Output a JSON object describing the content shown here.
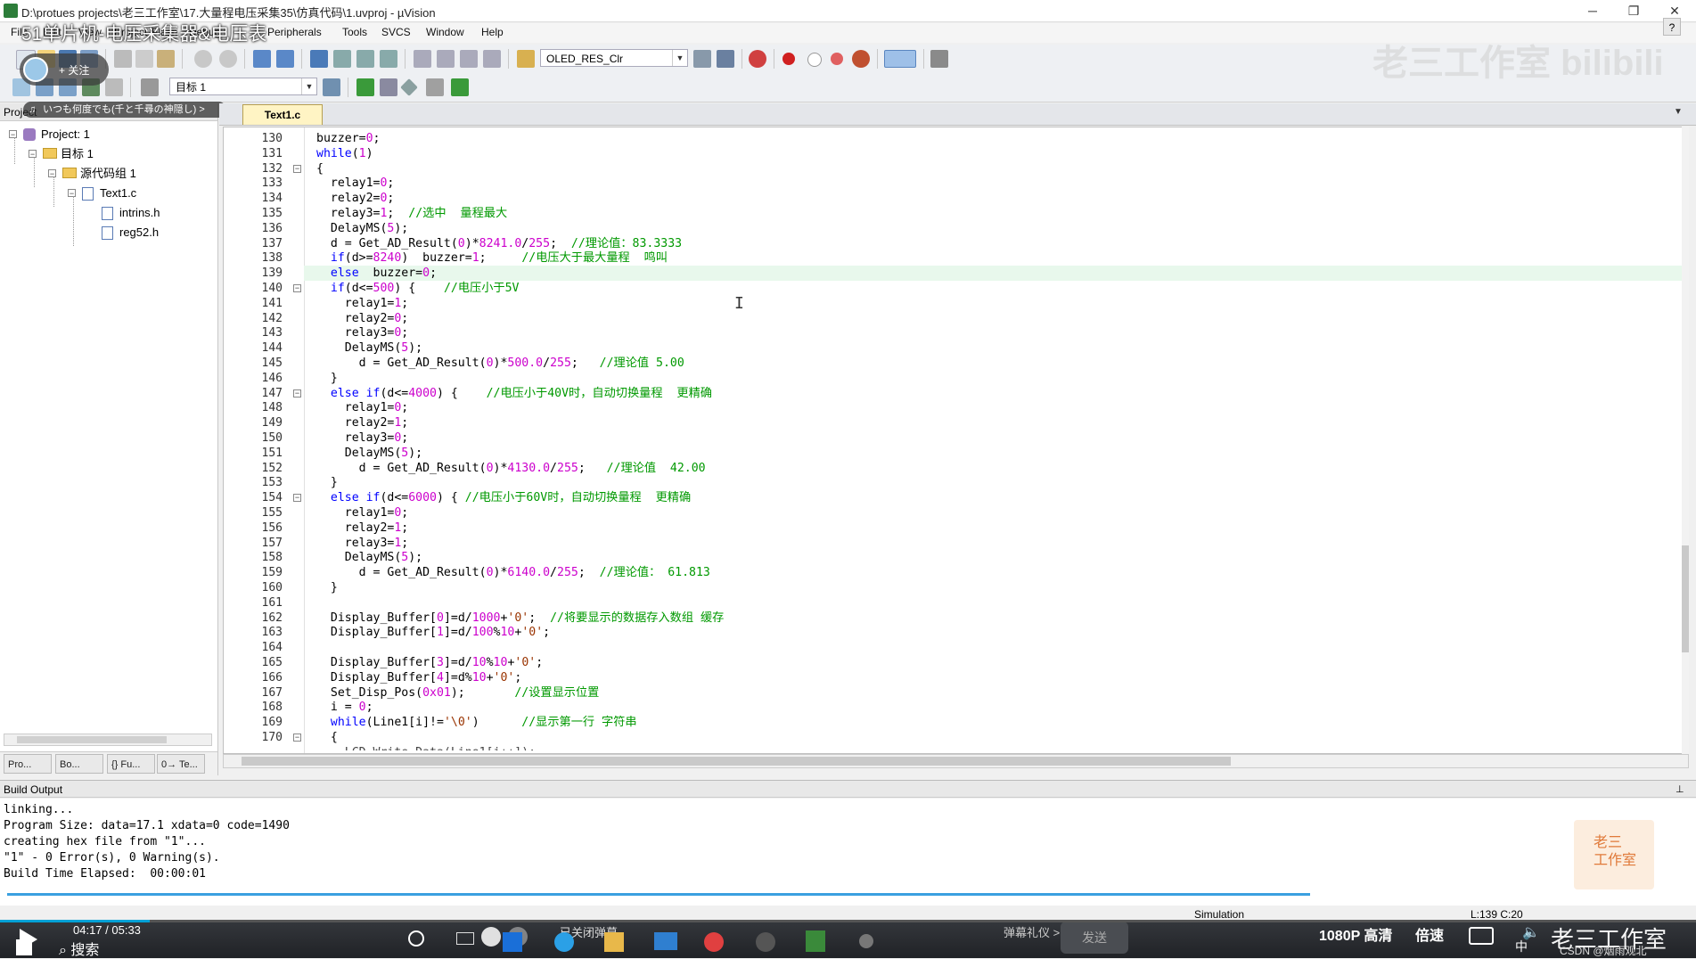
{
  "window": {
    "title": "D:\\protues projects\\老三工作室\\17.大量程电压采集35\\仿真代码\\1.uvproj - µVision",
    "minimize_glyph": "─",
    "maximize_glyph": "❐",
    "close_glyph": "✕",
    "help_glyph": "?"
  },
  "overlay": {
    "video_title": "51单片机-电压采集器&电压表",
    "follow_label": "+ 关注",
    "music_text": "いつも何度でも(千と千尋の神隠し) >",
    "watermark": "老三工作室 bilibili"
  },
  "menubar": [
    "File",
    "Edit",
    "View",
    "Project",
    "Flash",
    "Debug",
    "Peripherals",
    "Tools",
    "SVCS",
    "Window",
    "Help"
  ],
  "toolbar": {
    "target_combo": "OLED_RES_Clr",
    "target_select": "目标 1"
  },
  "project_panel": {
    "header": "Project",
    "tree": [
      {
        "label": "Project: 1",
        "level": 0,
        "icon": "project-icon",
        "expander": "-"
      },
      {
        "label": "目标 1",
        "level": 1,
        "icon": "target-folder-icon",
        "expander": "-"
      },
      {
        "label": "源代码组 1",
        "level": 2,
        "icon": "folder-icon",
        "expander": "-"
      },
      {
        "label": "Text1.c",
        "level": 3,
        "icon": "file-icon",
        "expander": "-"
      },
      {
        "label": "intrins.h",
        "level": 4,
        "icon": "header-file-icon",
        "expander": ""
      },
      {
        "label": "reg52.h",
        "level": 4,
        "icon": "header-file-icon",
        "expander": ""
      }
    ],
    "tabs": [
      "Pro...",
      "Bo...",
      "{} Fu...",
      "0→ Te..."
    ]
  },
  "editor": {
    "tab_label": "Text1.c",
    "cursor_position": "L:139 C:20",
    "highlighted_line": 139,
    "lines": [
      {
        "n": "130",
        "fold": "",
        "code": [
          [
            "buzzer=",
            ""
          ],
          [
            "0",
            "num"
          ],
          [
            ";",
            ""
          ]
        ]
      },
      {
        "n": "131",
        "fold": "",
        "code": [
          [
            "while",
            "kw"
          ],
          [
            "(",
            ""
          ],
          [
            "1",
            "num"
          ],
          [
            ")",
            ""
          ]
        ]
      },
      {
        "n": "132",
        "fold": "-",
        "code": [
          [
            "{",
            ""
          ]
        ]
      },
      {
        "n": "133",
        "fold": "",
        "code": [
          [
            "  relay1=",
            ""
          ],
          [
            "0",
            "num"
          ],
          [
            ";",
            ""
          ]
        ]
      },
      {
        "n": "134",
        "fold": "",
        "code": [
          [
            "  relay2=",
            ""
          ],
          [
            "0",
            "num"
          ],
          [
            ";",
            ""
          ]
        ]
      },
      {
        "n": "135",
        "fold": "",
        "code": [
          [
            "  relay3=",
            ""
          ],
          [
            "1",
            "num"
          ],
          [
            ";  ",
            ""
          ],
          [
            "//选中  量程最大",
            "cmt"
          ]
        ]
      },
      {
        "n": "136",
        "fold": "",
        "code": [
          [
            "  DelayMS(",
            ""
          ],
          [
            "5",
            "num"
          ],
          [
            ");",
            ""
          ]
        ]
      },
      {
        "n": "137",
        "fold": "",
        "code": [
          [
            "  d = Get_AD_Result(",
            ""
          ],
          [
            "0",
            "num"
          ],
          [
            ")*",
            ""
          ],
          [
            "8241.0",
            "num"
          ],
          [
            "/",
            ""
          ],
          [
            "255",
            "num"
          ],
          [
            ";  ",
            ""
          ],
          [
            "//理论值：83.3333",
            "cmt"
          ]
        ]
      },
      {
        "n": "138",
        "fold": "",
        "code": [
          [
            "  ",
            ""
          ],
          [
            "if",
            "kw"
          ],
          [
            "(d>=",
            ""
          ],
          [
            "8240",
            "num"
          ],
          [
            ")  buzzer=",
            ""
          ],
          [
            "1",
            "num"
          ],
          [
            ";     ",
            ""
          ],
          [
            "//电压大于最大量程  鸣叫",
            "cmt"
          ]
        ]
      },
      {
        "n": "139",
        "fold": "",
        "code": [
          [
            "  ",
            ""
          ],
          [
            "else",
            "kw"
          ],
          [
            "  buzzer=",
            ""
          ],
          [
            "0",
            "num"
          ],
          [
            ";",
            ""
          ]
        ]
      },
      {
        "n": "140",
        "fold": "-",
        "code": [
          [
            "  ",
            ""
          ],
          [
            "if",
            "kw"
          ],
          [
            "(d<=",
            ""
          ],
          [
            "500",
            "num"
          ],
          [
            ") {    ",
            ""
          ],
          [
            "//电压小于5V",
            "cmt"
          ]
        ]
      },
      {
        "n": "141",
        "fold": "",
        "code": [
          [
            "    relay1=",
            ""
          ],
          [
            "1",
            "num"
          ],
          [
            ";",
            ""
          ]
        ]
      },
      {
        "n": "142",
        "fold": "",
        "code": [
          [
            "    relay2=",
            ""
          ],
          [
            "0",
            "num"
          ],
          [
            ";",
            ""
          ]
        ]
      },
      {
        "n": "143",
        "fold": "",
        "code": [
          [
            "    relay3=",
            ""
          ],
          [
            "0",
            "num"
          ],
          [
            ";",
            ""
          ]
        ]
      },
      {
        "n": "144",
        "fold": "",
        "code": [
          [
            "    DelayMS(",
            ""
          ],
          [
            "5",
            "num"
          ],
          [
            ");",
            ""
          ]
        ]
      },
      {
        "n": "145",
        "fold": "",
        "code": [
          [
            "      d = Get_AD_Result(",
            ""
          ],
          [
            "0",
            "num"
          ],
          [
            ")*",
            ""
          ],
          [
            "500.0",
            "num"
          ],
          [
            "/",
            ""
          ],
          [
            "255",
            "num"
          ],
          [
            ";   ",
            ""
          ],
          [
            "//理论值 5.00",
            "cmt"
          ]
        ]
      },
      {
        "n": "146",
        "fold": "",
        "code": [
          [
            "  }",
            ""
          ]
        ]
      },
      {
        "n": "147",
        "fold": "-",
        "code": [
          [
            "  ",
            ""
          ],
          [
            "else if",
            "kw"
          ],
          [
            "(d<=",
            ""
          ],
          [
            "4000",
            "num"
          ],
          [
            ") {    ",
            ""
          ],
          [
            "//电压小于40V时，自动切换量程  更精确",
            "cmt"
          ]
        ]
      },
      {
        "n": "148",
        "fold": "",
        "code": [
          [
            "    relay1=",
            ""
          ],
          [
            "0",
            "num"
          ],
          [
            ";",
            ""
          ]
        ]
      },
      {
        "n": "149",
        "fold": "",
        "code": [
          [
            "    relay2=",
            ""
          ],
          [
            "1",
            "num"
          ],
          [
            ";",
            ""
          ]
        ]
      },
      {
        "n": "150",
        "fold": "",
        "code": [
          [
            "    relay3=",
            ""
          ],
          [
            "0",
            "num"
          ],
          [
            ";",
            ""
          ]
        ]
      },
      {
        "n": "151",
        "fold": "",
        "code": [
          [
            "    DelayMS(",
            ""
          ],
          [
            "5",
            "num"
          ],
          [
            ");",
            ""
          ]
        ]
      },
      {
        "n": "152",
        "fold": "",
        "code": [
          [
            "      d = Get_AD_Result(",
            ""
          ],
          [
            "0",
            "num"
          ],
          [
            ")*",
            ""
          ],
          [
            "4130.0",
            "num"
          ],
          [
            "/",
            ""
          ],
          [
            "255",
            "num"
          ],
          [
            ";   ",
            ""
          ],
          [
            "//理论值  42.00",
            "cmt"
          ]
        ]
      },
      {
        "n": "153",
        "fold": "",
        "code": [
          [
            "  }",
            ""
          ]
        ]
      },
      {
        "n": "154",
        "fold": "-",
        "code": [
          [
            "  ",
            ""
          ],
          [
            "else if",
            "kw"
          ],
          [
            "(d<=",
            ""
          ],
          [
            "6000",
            "num"
          ],
          [
            ") { ",
            ""
          ],
          [
            "//电压小于60V时，自动切换量程  更精确",
            "cmt"
          ]
        ]
      },
      {
        "n": "155",
        "fold": "",
        "code": [
          [
            "    relay1=",
            ""
          ],
          [
            "0",
            "num"
          ],
          [
            ";",
            ""
          ]
        ]
      },
      {
        "n": "156",
        "fold": "",
        "code": [
          [
            "    relay2=",
            ""
          ],
          [
            "1",
            "num"
          ],
          [
            ";",
            ""
          ]
        ]
      },
      {
        "n": "157",
        "fold": "",
        "code": [
          [
            "    relay3=",
            ""
          ],
          [
            "1",
            "num"
          ],
          [
            ";",
            ""
          ]
        ]
      },
      {
        "n": "158",
        "fold": "",
        "code": [
          [
            "    DelayMS(",
            ""
          ],
          [
            "5",
            "num"
          ],
          [
            ");",
            ""
          ]
        ]
      },
      {
        "n": "159",
        "fold": "",
        "code": [
          [
            "      d = Get_AD_Result(",
            ""
          ],
          [
            "0",
            "num"
          ],
          [
            ")*",
            ""
          ],
          [
            "6140.0",
            "num"
          ],
          [
            "/",
            ""
          ],
          [
            "255",
            "num"
          ],
          [
            ";  ",
            ""
          ],
          [
            "//理论值： 61.813",
            "cmt"
          ]
        ]
      },
      {
        "n": "160",
        "fold": "",
        "code": [
          [
            "  }",
            ""
          ]
        ]
      },
      {
        "n": "161",
        "fold": "",
        "code": []
      },
      {
        "n": "162",
        "fold": "",
        "code": [
          [
            "  Display_Buffer[",
            ""
          ],
          [
            "0",
            "num"
          ],
          [
            "]=d/",
            ""
          ],
          [
            "1000",
            "num"
          ],
          [
            "+",
            ""
          ],
          [
            "'0'",
            "str"
          ],
          [
            ";  ",
            ""
          ],
          [
            "//将要显示的数据存入数组 缓存",
            "cmt"
          ]
        ]
      },
      {
        "n": "163",
        "fold": "",
        "code": [
          [
            "  Display_Buffer[",
            ""
          ],
          [
            "1",
            "num"
          ],
          [
            "]=d/",
            ""
          ],
          [
            "100",
            "num"
          ],
          [
            "%",
            ""
          ],
          [
            "10",
            "num"
          ],
          [
            "+",
            ""
          ],
          [
            "'0'",
            "str"
          ],
          [
            ";",
            ""
          ]
        ]
      },
      {
        "n": "164",
        "fold": "",
        "code": []
      },
      {
        "n": "165",
        "fold": "",
        "code": [
          [
            "  Display_Buffer[",
            ""
          ],
          [
            "3",
            "num"
          ],
          [
            "]=d/",
            ""
          ],
          [
            "10",
            "num"
          ],
          [
            "%",
            ""
          ],
          [
            "10",
            "num"
          ],
          [
            "+",
            ""
          ],
          [
            "'0'",
            "str"
          ],
          [
            ";",
            ""
          ]
        ]
      },
      {
        "n": "166",
        "fold": "",
        "code": [
          [
            "  Display_Buffer[",
            ""
          ],
          [
            "4",
            "num"
          ],
          [
            "]=d%",
            ""
          ],
          [
            "10",
            "num"
          ],
          [
            "+",
            ""
          ],
          [
            "'0'",
            "str"
          ],
          [
            ";",
            ""
          ]
        ]
      },
      {
        "n": "167",
        "fold": "",
        "code": [
          [
            "  Set_Disp_Pos(",
            ""
          ],
          [
            "0x01",
            "num"
          ],
          [
            ");       ",
            ""
          ],
          [
            "//设置显示位置",
            "cmt"
          ]
        ]
      },
      {
        "n": "168",
        "fold": "",
        "code": [
          [
            "  i = ",
            ""
          ],
          [
            "0",
            "num"
          ],
          [
            ";",
            ""
          ]
        ]
      },
      {
        "n": "169",
        "fold": "",
        "code": [
          [
            "  ",
            ""
          ],
          [
            "while",
            "kw"
          ],
          [
            "(Line1[i]!=",
            ""
          ],
          [
            "'\\0'",
            "str"
          ],
          [
            ")      ",
            ""
          ],
          [
            "//显示第一行 字符串",
            "cmt"
          ]
        ]
      },
      {
        "n": "170",
        "fold": "-",
        "code": [
          [
            "  {",
            ""
          ]
        ]
      }
    ]
  },
  "build_output": {
    "header": "Build Output",
    "pin_glyph": "📌",
    "lines": [
      "linking...",
      "Program Size: data=17.1 xdata=0 code=1490",
      "creating hex file from \"1\"...",
      "\"1\" - 0 Error(s), 0 Warning(s).",
      "Build Time Elapsed:  00:00:01"
    ]
  },
  "statusbar": {
    "mode": "Simulation",
    "position": "L:139 C:20"
  },
  "video_bar": {
    "time": "04:17 / 05:33",
    "search_label": "搜索",
    "danmaku_off": "已关闭弹幕",
    "danmaku_etiquette": "弹幕礼仪 >",
    "send_label": "发送",
    "quality": "1080P 高清",
    "speed": "倍速",
    "csdn": "CSDN @烟雨观北",
    "studio_logo": "老三工作室",
    "badge_text": "老三\n工作室",
    "ime": "中",
    "progress": 0.771
  }
}
